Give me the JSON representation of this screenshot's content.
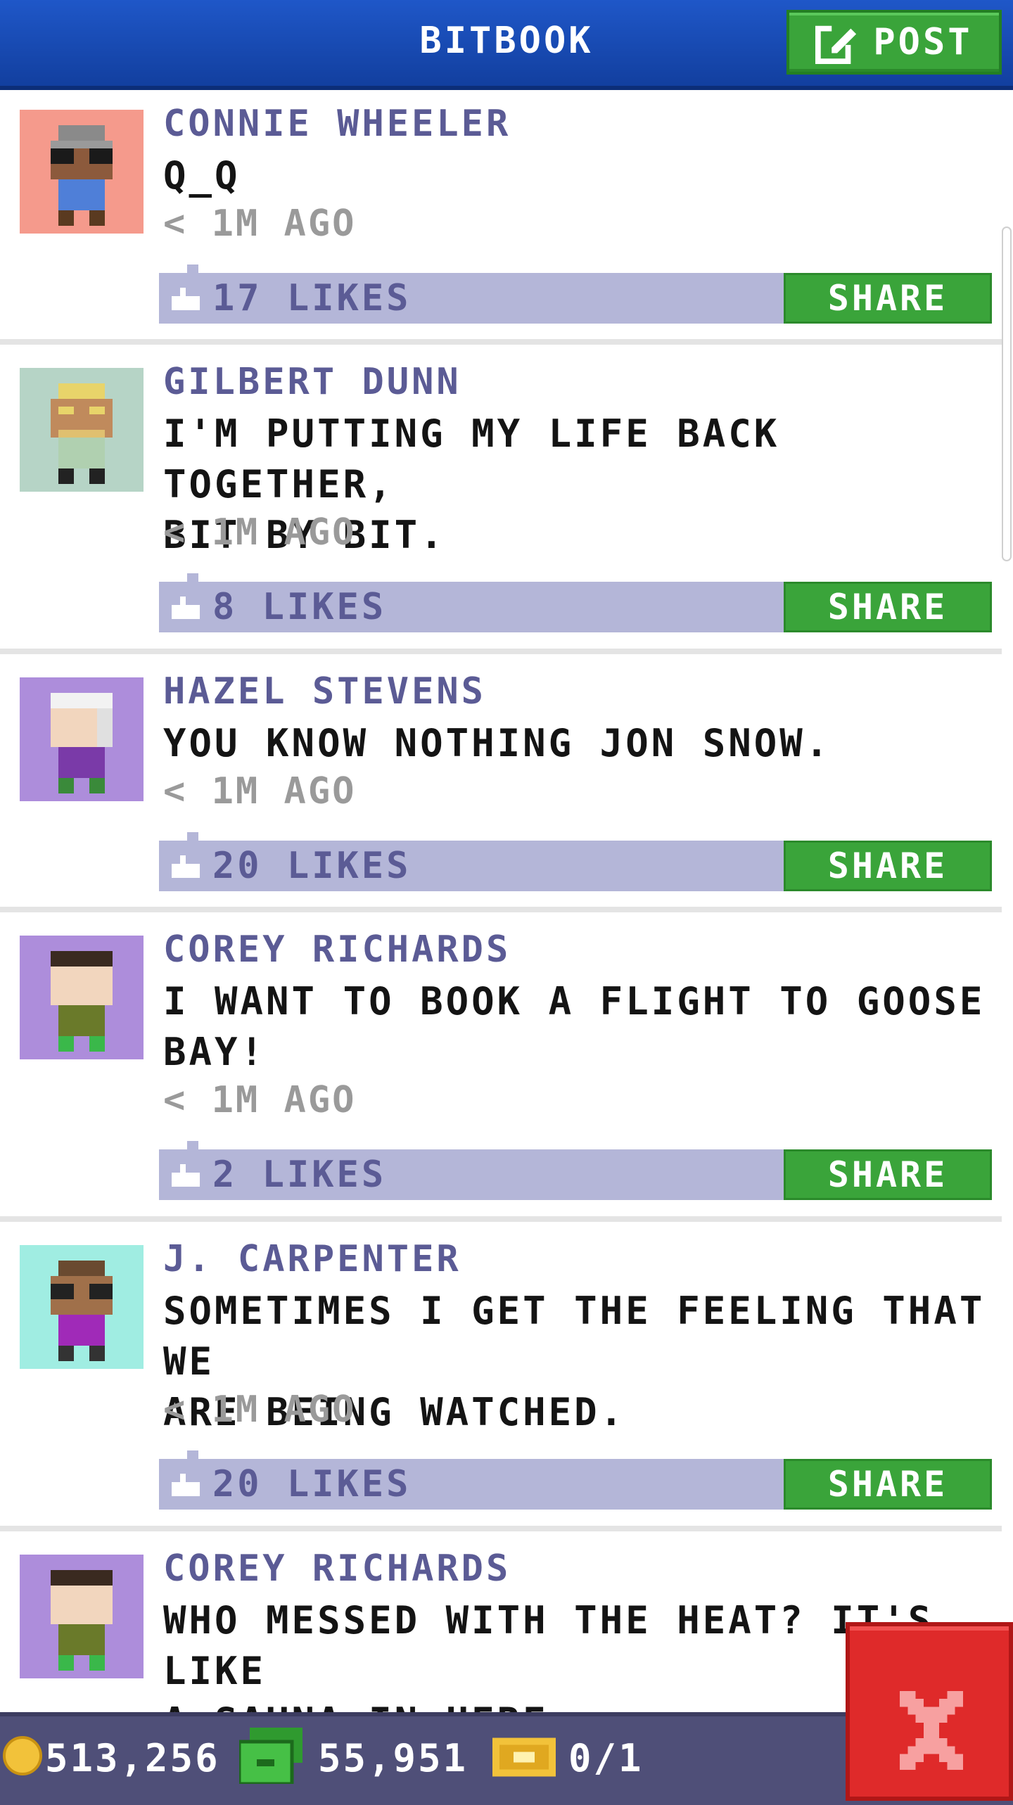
{
  "header": {
    "title": "BITBOOK",
    "post_label": "POST"
  },
  "posts": [
    {
      "name": "CONNIE WHEELER",
      "message": "Q_Q",
      "time": "< 1M AGO",
      "likes": "17 LIKES",
      "share": "SHARE",
      "avatar_bg": "#f59a8c"
    },
    {
      "name": "GILBERT DUNN",
      "message": "I'M PUTTING MY LIFE BACK TOGETHER,\nBIT BY BIT.",
      "time": "< 1M AGO",
      "likes": "8 LIKES",
      "share": "SHARE",
      "avatar_bg": "#b6d4c6"
    },
    {
      "name": "HAZEL STEVENS",
      "message": "YOU KNOW NOTHING JON SNOW.",
      "time": "< 1M AGO",
      "likes": "20 LIKES",
      "share": "SHARE",
      "avatar_bg": "#ad8ddb"
    },
    {
      "name": "COREY RICHARDS",
      "message": "I WANT TO BOOK A FLIGHT TO GOOSE\nBAY!",
      "time": "< 1M AGO",
      "likes": "2 LIKES",
      "share": "SHARE",
      "avatar_bg": "#ad8ddb"
    },
    {
      "name": "J. CARPENTER",
      "message": "SOMETIMES I GET THE FEELING THAT WE\nARE BEING WATCHED.",
      "time": "< 1M AGO",
      "likes": "20 LIKES",
      "share": "SHARE",
      "avatar_bg": "#a0ede2"
    },
    {
      "name": "COREY RICHARDS",
      "message": "WHO MESSED WITH THE HEAT? IT'S LIKE\nA SAUNA IN HERE.",
      "time": "",
      "likes": "",
      "share": "",
      "avatar_bg": "#ad8ddb"
    }
  ],
  "status": {
    "coins": "513,256",
    "bux": "55,951",
    "tickets": "0/1"
  },
  "colors": {
    "header_blue": "#1f57c8",
    "button_green": "#3aa43a",
    "like_bar": "#b4b6d8",
    "name_purple": "#5b5b95",
    "close_red": "#df2a2a",
    "status_bar": "#4f4f78"
  },
  "icons": {
    "post": "compose-icon",
    "like": "thumbs-up-icon",
    "coin": "coin-icon",
    "bux": "cash-icon",
    "ticket": "ticket-icon",
    "close": "close-icon"
  }
}
